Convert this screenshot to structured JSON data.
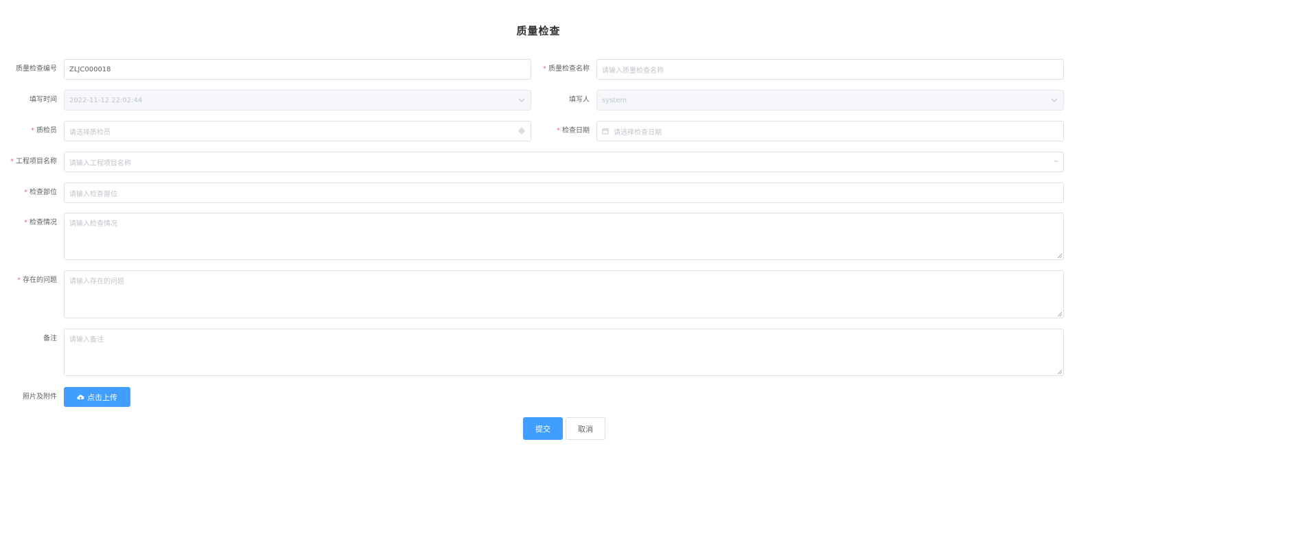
{
  "page": {
    "title": "质量检查"
  },
  "form": {
    "code": {
      "label": "质量检查编号",
      "value": "ZLJC000018"
    },
    "name": {
      "label": "质量检查名称",
      "placeholder": "请输入质量检查名称",
      "required": "*"
    },
    "fill_time": {
      "label": "填写时间",
      "value": "2022-11-12 22:02:44"
    },
    "filler": {
      "label": "填写人",
      "value": "system"
    },
    "inspector": {
      "label": "质检员",
      "placeholder": "请选择质检员",
      "required": "*"
    },
    "check_date": {
      "label": "检查日期",
      "placeholder": "请选择检查日期",
      "required": "*"
    },
    "project": {
      "label": "工程项目名称",
      "placeholder": "请输入工程项目名称",
      "required": "*",
      "suffix": "···"
    },
    "part": {
      "label": "检查部位",
      "placeholder": "请输入检查部位",
      "required": "*"
    },
    "situation": {
      "label": "检查情况",
      "placeholder": "请输入检查情况",
      "required": "*"
    },
    "problems": {
      "label": "存在的问题",
      "placeholder": "请输入存在的问题",
      "required": "*"
    },
    "remark": {
      "label": "备注",
      "placeholder": "请输入备注"
    },
    "attachments": {
      "label": "照片及附件",
      "upload_label": "点击上传"
    }
  },
  "actions": {
    "submit": "提交",
    "cancel": "取消"
  },
  "colors": {
    "primary": "#409eff",
    "required": "#f56c6c",
    "border": "#dcdfe6",
    "placeholder": "#c0c4cc"
  }
}
